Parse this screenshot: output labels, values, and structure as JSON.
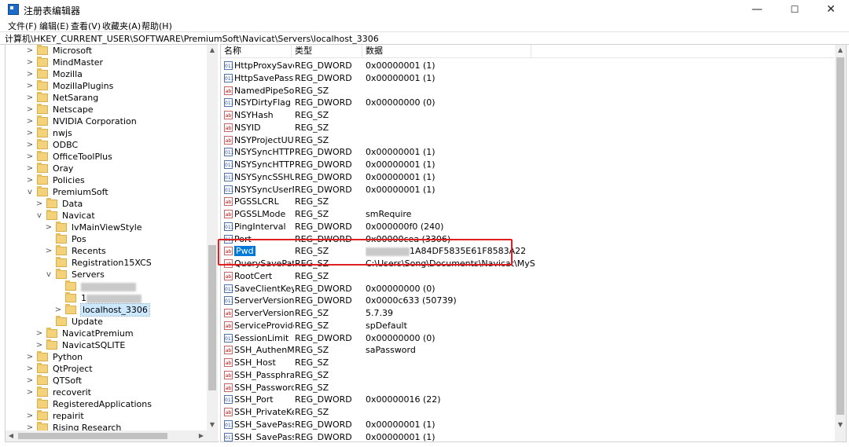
{
  "window": {
    "title": "注册表编辑器",
    "minimize": "—",
    "maximize": "☐",
    "close": "✕"
  },
  "menu": [
    "文件(F)",
    "编辑(E)",
    "查看(V)",
    "收藏夹(A)",
    "帮助(H)"
  ],
  "address": "计算机\\HKEY_CURRENT_USER\\SOFTWARE\\PremiumSoft\\Navicat\\Servers\\localhost_3306",
  "tree": [
    {
      "label": "Microsoft",
      "level": 0,
      "expander": ">"
    },
    {
      "label": "MindMaster",
      "level": 0,
      "expander": ">"
    },
    {
      "label": "Mozilla",
      "level": 0,
      "expander": ">"
    },
    {
      "label": "MozillaPlugins",
      "level": 0,
      "expander": ">"
    },
    {
      "label": "NetSarang",
      "level": 0,
      "expander": ">"
    },
    {
      "label": "Netscape",
      "level": 0,
      "expander": ">"
    },
    {
      "label": "NVIDIA Corporation",
      "level": 0,
      "expander": ">"
    },
    {
      "label": "nwjs",
      "level": 0,
      "expander": ">"
    },
    {
      "label": "ODBC",
      "level": 0,
      "expander": ">"
    },
    {
      "label": "OfficeToolPlus",
      "level": 0,
      "expander": ">"
    },
    {
      "label": "Oray",
      "level": 0,
      "expander": ">"
    },
    {
      "label": "Policies",
      "level": 0,
      "expander": ">"
    },
    {
      "label": "PremiumSoft",
      "level": 0,
      "expander": "v"
    },
    {
      "label": "Data",
      "level": 1,
      "expander": ">"
    },
    {
      "label": "Navicat",
      "level": 1,
      "expander": "v"
    },
    {
      "label": "lvMainViewStyle",
      "level": 2,
      "expander": ">"
    },
    {
      "label": "Pos",
      "level": 2,
      "expander": ""
    },
    {
      "label": "Recents",
      "level": 2,
      "expander": ">"
    },
    {
      "label": "Registration15XCS",
      "level": 2,
      "expander": ""
    },
    {
      "label": "Servers",
      "level": 2,
      "expander": "v"
    },
    {
      "label": "",
      "level": 3,
      "expander": "",
      "blurred": true
    },
    {
      "label": "1",
      "level": 3,
      "expander": "",
      "blurred": true
    },
    {
      "label": "localhost_3306",
      "level": 3,
      "expander": ">",
      "selected": true
    },
    {
      "label": "Update",
      "level": 2,
      "expander": ""
    },
    {
      "label": "NavicatPremium",
      "level": 1,
      "expander": ">"
    },
    {
      "label": "NavicatSQLITE",
      "level": 1,
      "expander": ">"
    },
    {
      "label": "Python",
      "level": 0,
      "expander": ">"
    },
    {
      "label": "QtProject",
      "level": 0,
      "expander": ">"
    },
    {
      "label": "QTSoft",
      "level": 0,
      "expander": ">"
    },
    {
      "label": "recoverit",
      "level": 0,
      "expander": ">"
    },
    {
      "label": "RegisteredApplications",
      "level": 0,
      "expander": ""
    },
    {
      "label": "repairit",
      "level": 0,
      "expander": ">"
    },
    {
      "label": "Rising Research",
      "level": 0,
      "expander": ">"
    }
  ],
  "columns": {
    "name": "名称",
    "type": "类型",
    "data": "数据"
  },
  "values": [
    {
      "name": "HttpProxySave...",
      "type": "REG_DWORD",
      "data": "0x00000001 (1)",
      "icon": "dword"
    },
    {
      "name": "HttpSavePassw...",
      "type": "REG_DWORD",
      "data": "0x00000001 (1)",
      "icon": "dword"
    },
    {
      "name": "NamedPipeSo...",
      "type": "REG_SZ",
      "data": "",
      "icon": "sz"
    },
    {
      "name": "NSYDirtyFlag",
      "type": "REG_DWORD",
      "data": "0x00000000 (0)",
      "icon": "dword"
    },
    {
      "name": "NSYHash",
      "type": "REG_SZ",
      "data": "",
      "icon": "sz"
    },
    {
      "name": "NSYID",
      "type": "REG_SZ",
      "data": "",
      "icon": "sz"
    },
    {
      "name": "NSYProjectUUID",
      "type": "REG_SZ",
      "data": "",
      "icon": "sz"
    },
    {
      "name": "NSYSyncHTTPP...",
      "type": "REG_DWORD",
      "data": "0x00000001 (1)",
      "icon": "dword"
    },
    {
      "name": "NSYSyncHTTP...",
      "type": "REG_DWORD",
      "data": "0x00000001 (1)",
      "icon": "dword"
    },
    {
      "name": "NSYSyncSSHU...",
      "type": "REG_DWORD",
      "data": "0x00000001 (1)",
      "icon": "dword"
    },
    {
      "name": "NSYSyncUserN...",
      "type": "REG_DWORD",
      "data": "0x00000001 (1)",
      "icon": "dword"
    },
    {
      "name": "PGSSLCRL",
      "type": "REG_SZ",
      "data": "",
      "icon": "sz"
    },
    {
      "name": "PGSSLMode",
      "type": "REG_SZ",
      "data": "smRequire",
      "icon": "sz"
    },
    {
      "name": "PingInterval",
      "type": "REG_DWORD",
      "data": "0x000000f0 (240)",
      "icon": "dword"
    },
    {
      "name": "Port",
      "type": "REG_DWORD",
      "data": "0x00000cea (3306)",
      "icon": "dword"
    },
    {
      "name": "Pwd",
      "type": "REG_SZ",
      "data": "1A84DF5835E61F8583A22",
      "icon": "sz",
      "selected": true,
      "blurred_prefix": true
    },
    {
      "name": "QuerySavePath",
      "type": "REG_SZ",
      "data": "C:\\Users\\Song\\Documents\\Navicat\\MySQL\\Se...",
      "icon": "sz"
    },
    {
      "name": "RootCert",
      "type": "REG_SZ",
      "data": "",
      "icon": "sz"
    },
    {
      "name": "SaveClientKeyP...",
      "type": "REG_DWORD",
      "data": "0x00000000 (0)",
      "icon": "dword"
    },
    {
      "name": "ServerVersion",
      "type": "REG_DWORD",
      "data": "0x0000c633 (50739)",
      "icon": "dword"
    },
    {
      "name": "ServerVersion...",
      "type": "REG_SZ",
      "data": "5.7.39",
      "icon": "sz"
    },
    {
      "name": "ServiceProvider",
      "type": "REG_SZ",
      "data": "spDefault",
      "icon": "sz"
    },
    {
      "name": "SessionLimit",
      "type": "REG_DWORD",
      "data": "0x00000000 (0)",
      "icon": "dword"
    },
    {
      "name": "SSH_AuthenMe...",
      "type": "REG_SZ",
      "data": "saPassword",
      "icon": "sz"
    },
    {
      "name": "SSH_Host",
      "type": "REG_SZ",
      "data": "",
      "icon": "sz"
    },
    {
      "name": "SSH_Passphrase",
      "type": "REG_SZ",
      "data": "",
      "icon": "sz"
    },
    {
      "name": "SSH_Password",
      "type": "REG_SZ",
      "data": "",
      "icon": "sz"
    },
    {
      "name": "SSH_Port",
      "type": "REG_DWORD",
      "data": "0x00000016 (22)",
      "icon": "dword"
    },
    {
      "name": "SSH_PrivateKey",
      "type": "REG_SZ",
      "data": "",
      "icon": "sz"
    },
    {
      "name": "SSH_SavePass...",
      "type": "REG_DWORD",
      "data": "0x00000001 (1)",
      "icon": "dword"
    },
    {
      "name": "SSH_SavePass...",
      "type": "REG_DWORD",
      "data": "0x00000001 (1)",
      "icon": "dword"
    }
  ],
  "icons": {
    "sz": "ab",
    "dword": "011"
  },
  "colors": {
    "selection": "#0078d7",
    "highlight_box": "#e02020"
  }
}
